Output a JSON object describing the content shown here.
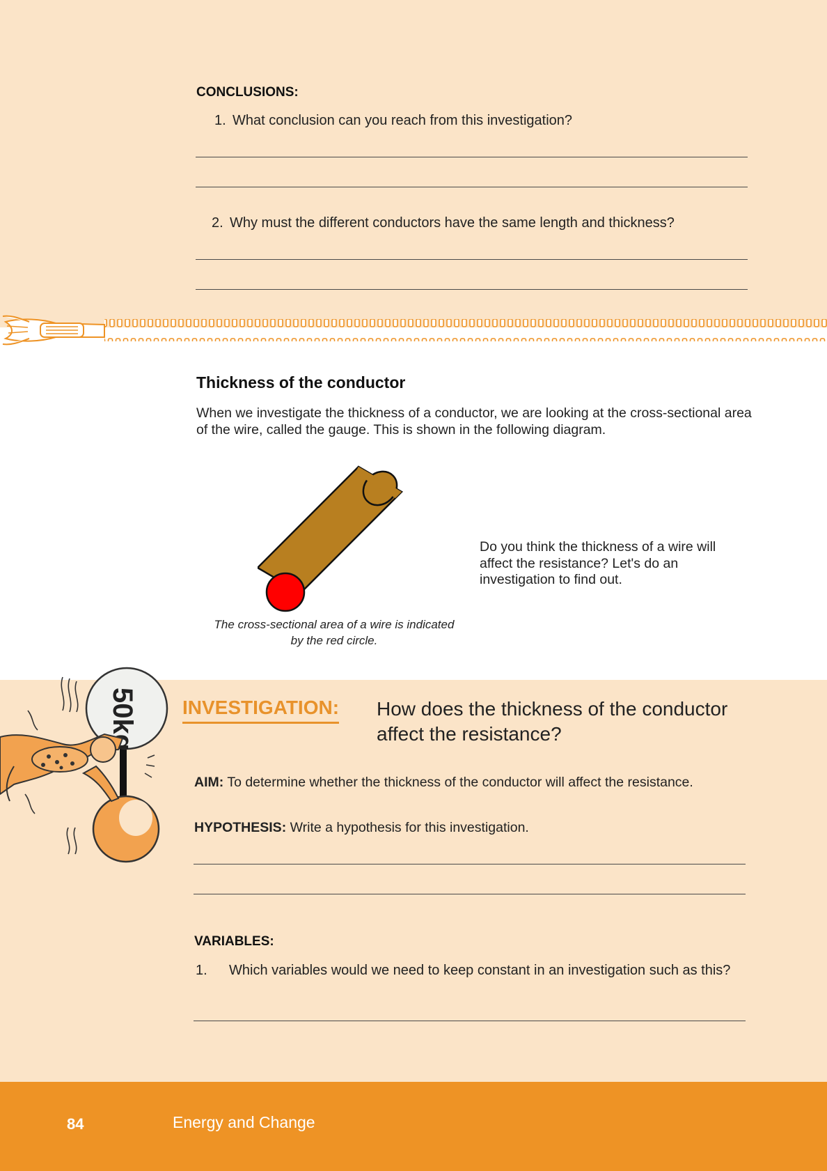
{
  "conclusions": {
    "label": "CONCLUSIONS:",
    "q1": {
      "num": "1.",
      "text": "What conclusion can you reach from this investigation?"
    },
    "q2": {
      "num": "2.",
      "text": "Why must the different conductors have the same length and thickness?"
    }
  },
  "thickness": {
    "heading": "Thickness of the conductor",
    "intro": "When we investigate the thickness of a conductor, we are looking at the cross-sectional area of the wire, called the gauge.  This is shown in the following diagram.",
    "caption": "The cross-sectional area of a wire is indicated by the red circle.",
    "side_text": "Do you think the thickness of a wire will affect the resistance? Let's do an investigation to find out."
  },
  "investigation": {
    "label": "INVESTIGATION:",
    "title": "How does the thickness of the conductor affect the resistance?",
    "weight_text": "50kg",
    "aim_label": "AIM:",
    "aim_text": " To determine whether the thickness of the conductor will affect the resistance.",
    "hypothesis_label": "HYPOTHESIS:",
    "hypothesis_text": " Write a hypothesis for this investigation.",
    "variables_label": "VARIABLES:",
    "v1": {
      "num": "1.",
      "text": "Which variables would we need to keep constant in an investigation such as this?"
    }
  },
  "footer": {
    "page_number": "84",
    "book_title": "Energy and Change"
  },
  "colors": {
    "cream": "#fbe4c8",
    "orange": "#ee9325",
    "wire": "#b87f20",
    "cross_section": "#ff0000"
  }
}
